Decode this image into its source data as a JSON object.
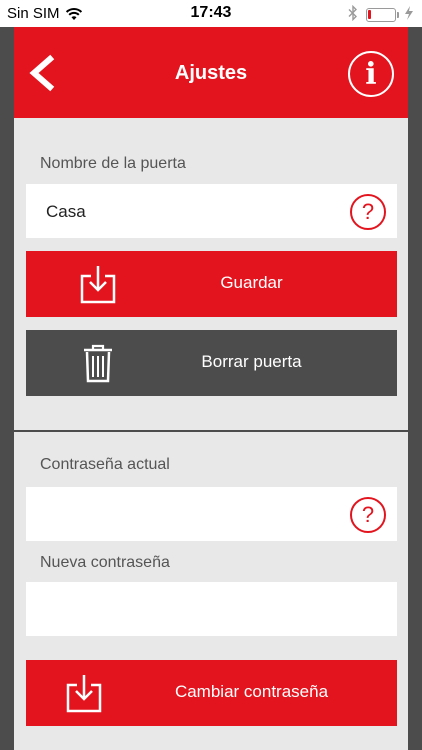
{
  "status": {
    "carrier": "Sin SIM",
    "time": "17:43"
  },
  "header": {
    "title": "Ajustes"
  },
  "door": {
    "name_label": "Nombre de la puerta",
    "name_value": "Casa",
    "save_label": "Guardar",
    "delete_label": "Borrar puerta"
  },
  "password": {
    "current_label": "Contraseña actual",
    "current_value": "",
    "new_label": "Nueva contraseña",
    "new_value": "",
    "change_label": "Cambiar contraseña"
  },
  "help_glyph": "?",
  "info_glyph": "i",
  "colors": {
    "accent": "#e3141e",
    "dark": "#4c4c4c",
    "panel": "#e8e8e8"
  }
}
